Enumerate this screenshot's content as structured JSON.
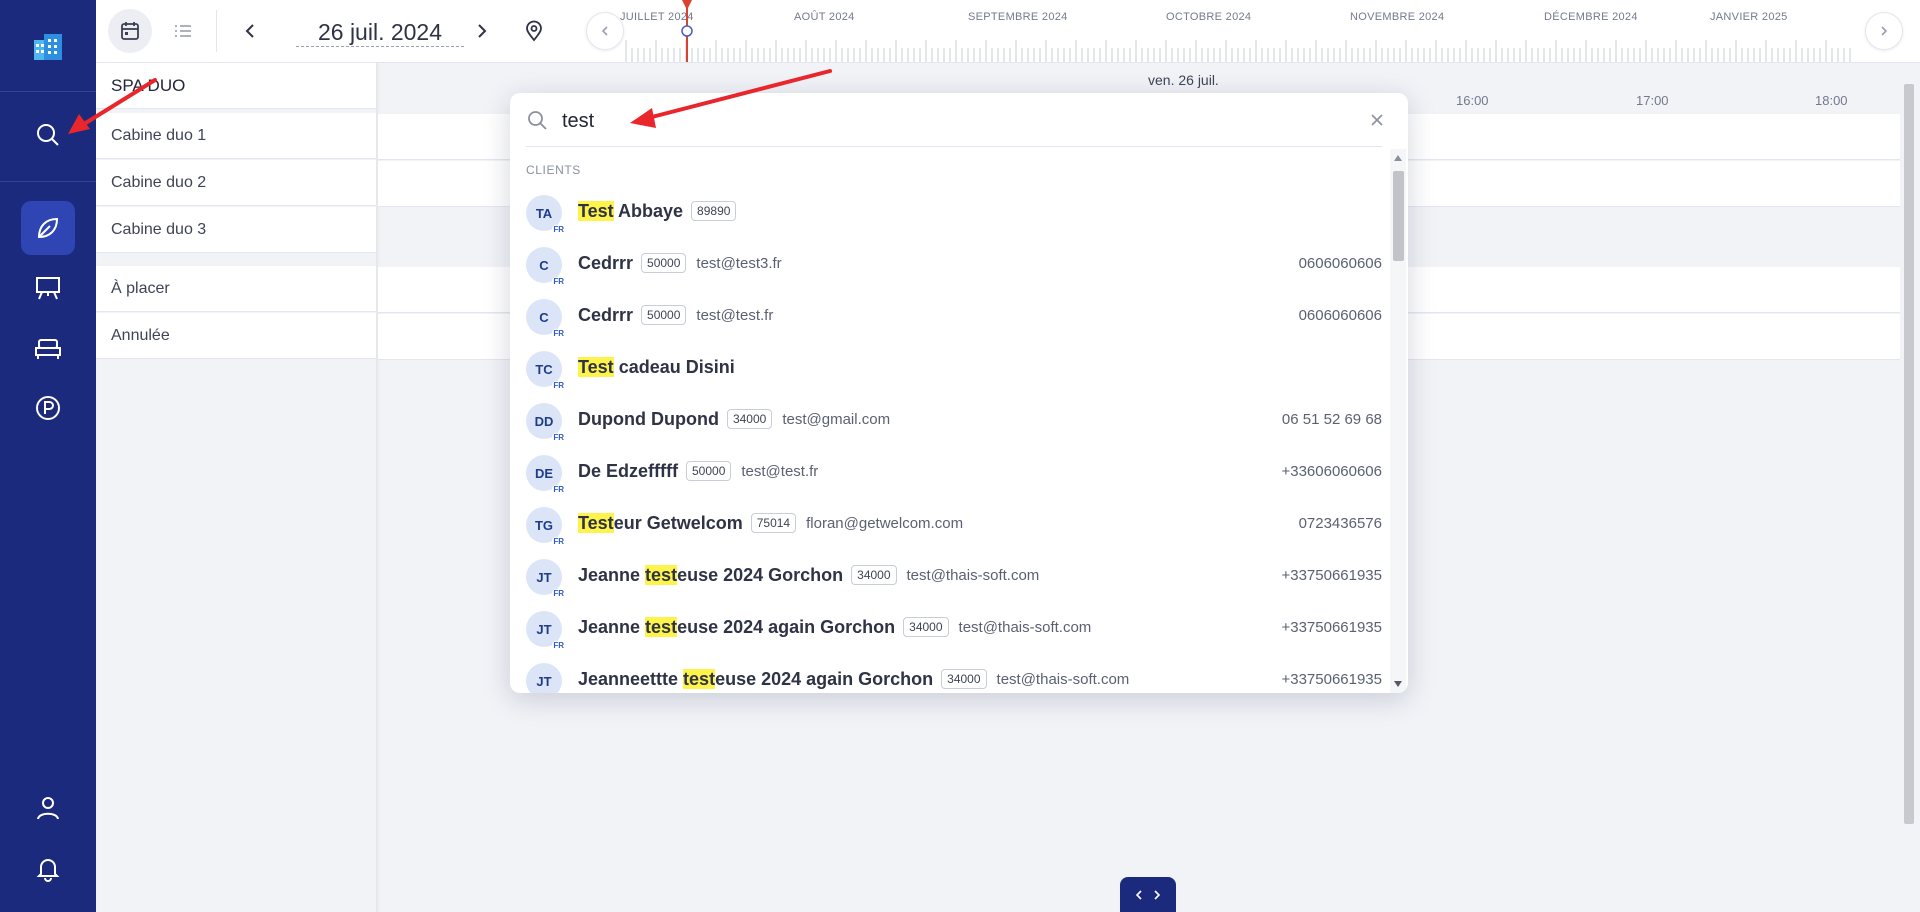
{
  "colors": {
    "sidebar": "#1c2a7e",
    "sidebar_active": "#2f45b3",
    "highlight": "#fef34a",
    "annotation": "#e8262b",
    "now_marker": "#d9422e"
  },
  "sidebar": {
    "icons": [
      "building-logo-icon",
      "search-icon",
      "leaf-icon",
      "presentation-icon",
      "bed-icon",
      "parking-icon",
      "user-icon",
      "bell-icon"
    ]
  },
  "toolbar": {
    "date": "26 juil. 2024"
  },
  "timeline": {
    "months": [
      "JUILLET 2024",
      "AOÛT 2024",
      "SEPTEMBRE 2024",
      "OCTOBRE 2024",
      "NOVEMBRE 2024",
      "DÉCEMBRE 2024",
      "JANVIER 2025"
    ]
  },
  "resources": {
    "group": "SPA DUO",
    "cabins": [
      "Cabine duo 1",
      "Cabine duo 2",
      "Cabine duo 3"
    ],
    "extra": [
      "À placer",
      "Annulée"
    ]
  },
  "grid": {
    "day": "ven. 26 juil.",
    "hours": [
      "16:00",
      "17:00",
      "18:00"
    ]
  },
  "search": {
    "query": "test",
    "section": "CLIENTS",
    "results": [
      {
        "initials": "TA",
        "country": "FR",
        "name_pre": "",
        "name_hl": "Test",
        "name_post": " Abbaye",
        "zip": "89890",
        "email": "",
        "phone": ""
      },
      {
        "initials": "C",
        "country": "FR",
        "name_pre": "Cedrrr",
        "name_hl": "",
        "name_post": "",
        "zip": "50000",
        "email": "test@test3.fr",
        "phone": "0606060606"
      },
      {
        "initials": "C",
        "country": "FR",
        "name_pre": "Cedrrr",
        "name_hl": "",
        "name_post": "",
        "zip": "50000",
        "email": "test@test.fr",
        "phone": "0606060606"
      },
      {
        "initials": "TC",
        "country": "FR",
        "name_pre": "",
        "name_hl": "Test",
        "name_post": " cadeau Disini",
        "zip": "",
        "email": "",
        "phone": ""
      },
      {
        "initials": "DD",
        "country": "FR",
        "name_pre": "Dupond Dupond",
        "name_hl": "",
        "name_post": "",
        "zip": "34000",
        "email": "test@gmail.com",
        "phone": "06 51 52 69 68"
      },
      {
        "initials": "DE",
        "country": "FR",
        "name_pre": "De Edzefffff",
        "name_hl": "",
        "name_post": "",
        "zip": "50000",
        "email": "test@test.fr",
        "phone": "+33606060606"
      },
      {
        "initials": "TG",
        "country": "FR",
        "name_pre": "",
        "name_hl": "Test",
        "name_post": "eur Getwelcom",
        "zip": "75014",
        "email": "floran@getwelcom.com",
        "phone": "0723436576"
      },
      {
        "initials": "JT",
        "country": "FR",
        "name_pre": "Jeanne ",
        "name_hl": "test",
        "name_post": "euse 2024 Gorchon",
        "zip": "34000",
        "email": "test@thais-soft.com",
        "phone": "+33750661935"
      },
      {
        "initials": "JT",
        "country": "FR",
        "name_pre": "Jeanne ",
        "name_hl": "test",
        "name_post": "euse 2024 again Gorchon",
        "zip": "34000",
        "email": "test@thais-soft.com",
        "phone": "+33750661935"
      },
      {
        "initials": "JT",
        "country": "FR",
        "name_pre": "Jeanneettte ",
        "name_hl": "test",
        "name_post": "euse 2024 again Gorchon",
        "zip": "34000",
        "email": "test@thais-soft.com",
        "phone": "+33750661935"
      }
    ]
  }
}
